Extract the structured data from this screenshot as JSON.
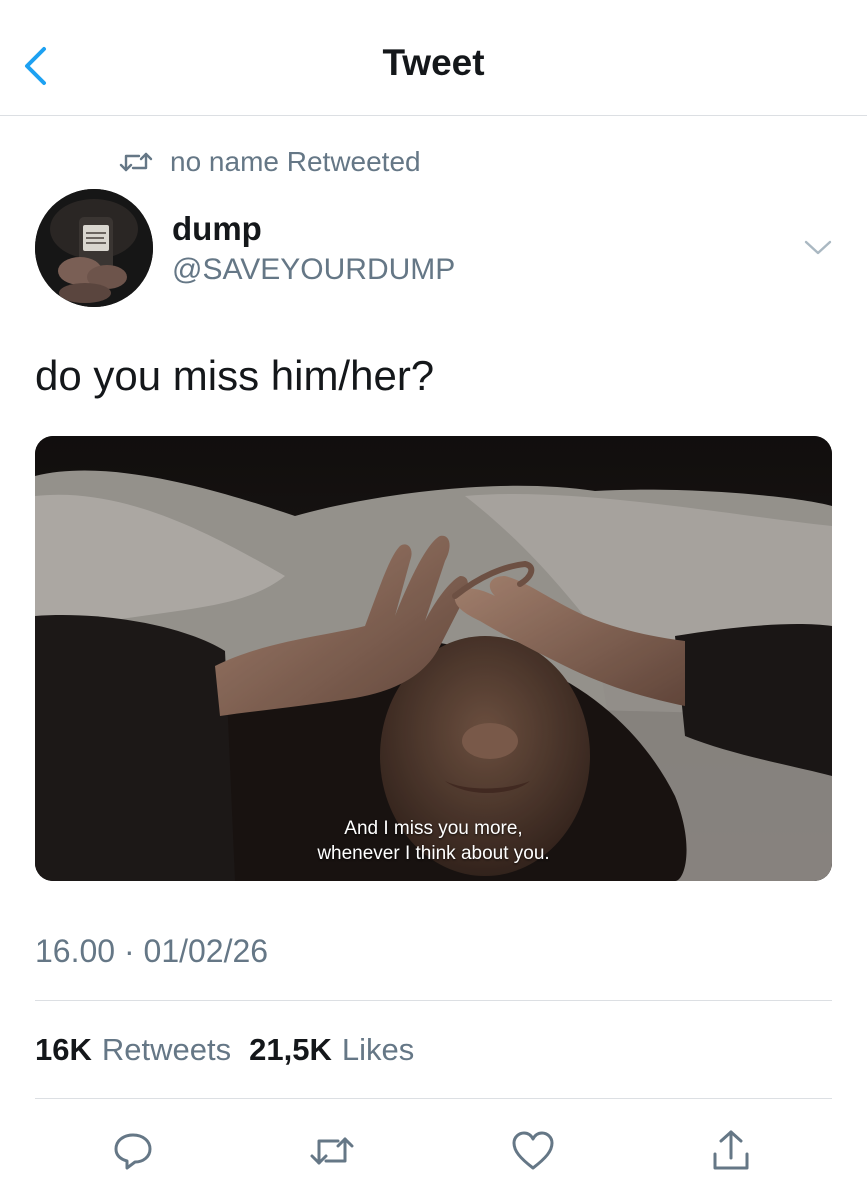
{
  "header": {
    "title": "Tweet",
    "back_icon": "chevron-left-icon"
  },
  "retweet_context": {
    "icon": "retweet-icon",
    "text": "no name Retweeted"
  },
  "author": {
    "name": "dump",
    "handle": "@SAVEYOURDUMP",
    "menu_icon": "chevron-down-icon"
  },
  "tweet": {
    "text": "do you miss him/her?",
    "media": {
      "subtitle_line1": "And I miss you more,",
      "subtitle_line2": "whenever I think about you."
    },
    "timestamp": "16.00 · 01/02/26"
  },
  "stats": {
    "retweets_count": "16K",
    "retweets_label": "Retweets",
    "likes_count": "21,5K",
    "likes_label": "Likes"
  },
  "actions": [
    {
      "icon": "reply-icon"
    },
    {
      "icon": "retweet-icon"
    },
    {
      "icon": "like-icon"
    },
    {
      "icon": "share-icon"
    }
  ],
  "colors": {
    "accent": "#1da1f2",
    "secondary_text": "#657786",
    "primary_text": "#14171a",
    "divider": "#dcdfe3"
  }
}
